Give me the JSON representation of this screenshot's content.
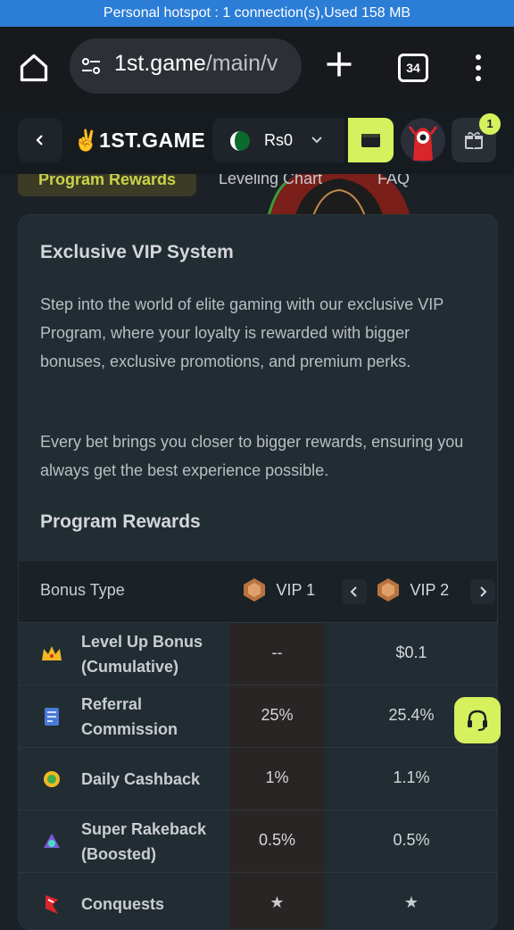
{
  "status_bar": {
    "text": "Personal hotspot : 1 connection(s),Used  158 MB"
  },
  "browser": {
    "url_host": "1st.game",
    "url_path": "/main/v",
    "tab_count": "34"
  },
  "site_header": {
    "logo_text": "1ST.GAME",
    "balance": "Rs0",
    "gift_badge": "1"
  },
  "nav_tabs": [
    {
      "label": "Program Rewards"
    },
    {
      "label": "Leveling Chart"
    },
    {
      "label": "FAQ"
    }
  ],
  "card": {
    "title": "Exclusive VIP System",
    "paragraph1": "Step into the world of elite gaming with our exclusive VIP Program, where your loyalty is rewarded with bigger bonuses, exclusive promotions, and premium perks.",
    "paragraph2": "Every bet brings you closer to bigger rewards, ensuring you always get the best experience possible.",
    "rewards_title": "Program Rewards"
  },
  "table": {
    "header_type": "Bonus Type",
    "vip1": "VIP 1",
    "vip2": "VIP 2",
    "rows": [
      {
        "icon": "crown-icon",
        "label": "Level Up Bonus (Cumulative)",
        "vip1": "--",
        "vip2": "$0.1"
      },
      {
        "icon": "referral-icon",
        "label": "Referral Commission",
        "vip1": "25%",
        "vip2": "25.4%"
      },
      {
        "icon": "cashback-icon",
        "label": "Daily Cashback",
        "vip1": "1%",
        "vip2": "1.1%"
      },
      {
        "icon": "rakeback-icon",
        "label": "Super Rakeback (Boosted)",
        "vip1": "0.5%",
        "vip2": "0.5%"
      },
      {
        "icon": "conquests-icon",
        "label": "Conquests",
        "vip1": "★",
        "vip2": "★"
      }
    ]
  },
  "colors": {
    "accent": "#d6f15d",
    "card_bg": "#222d33",
    "page_bg": "#1b2126",
    "vip1_col": "#2a2525"
  }
}
